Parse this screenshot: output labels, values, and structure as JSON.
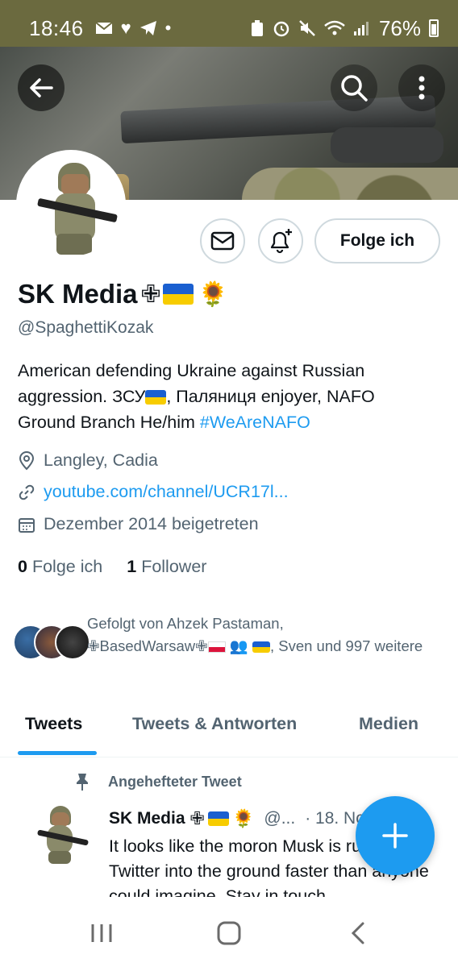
{
  "status_bar": {
    "time": "18:46",
    "battery": "76%"
  },
  "header": {
    "back_icon": "arrow-left-icon",
    "search_icon": "search-icon",
    "more_icon": "more-vertical-icon"
  },
  "profile": {
    "display_name": "SK Media",
    "handle": "@SpaghettiKozak",
    "bio_text": "American defending Ukraine against Russian aggression. ЗСУ",
    "bio_text_2": ", Паляниця enjoyer, NAFO Ground Branch He/him ",
    "bio_hashtag": "#WeAreNAFO",
    "location": "Langley, Cadia",
    "website": "youtube.com/channel/UCR17l...",
    "joined": "Dezember 2014 beigetreten",
    "following_count": "0",
    "following_label": "Folge ich",
    "followers_count": "1",
    "followers_label": "Follower",
    "followed_by_prefix": "Gefolgt von Ahzek Pastaman,",
    "followed_by_name2": "BasedWarsaw",
    "followed_by_suffix": ", Sven und 997 weitere"
  },
  "actions": {
    "follow_label": "Folge ich"
  },
  "tabs": [
    {
      "label": "Tweets"
    },
    {
      "label": "Tweets & Antworten"
    },
    {
      "label": "Medien"
    }
  ],
  "pinned_tweet": {
    "pinned_label": "Angehefteter Tweet",
    "author": "SK Media",
    "handle_trunc": "@...",
    "date": "· 18. No",
    "text": "It looks like the moron Musk is running Twitter into the ground faster than anyone could imagine. Stay in touch"
  },
  "colors": {
    "accent": "#1d9bf0",
    "status_bar": "#6b6a3f",
    "flag_blue": "#1a5fd0",
    "flag_yellow": "#f7cc00"
  }
}
